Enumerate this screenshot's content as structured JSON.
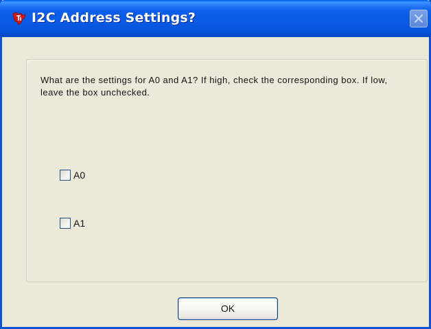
{
  "window": {
    "title": "I2C Address Settings?",
    "title_icon": "ti-logo-icon",
    "close_icon": "close-icon"
  },
  "dialog": {
    "prompt": "What are the settings for A0 and A1? If high, check the corresponding box. If low, leave the box unchecked.",
    "checkboxes": [
      {
        "label": "A0",
        "checked": false
      },
      {
        "label": "A1",
        "checked": false
      }
    ],
    "ok_label": "OK"
  },
  "colors": {
    "titlebar": "#0a5ae5",
    "window_bg": "#ece9d8",
    "logo": "#cc1a1a"
  }
}
